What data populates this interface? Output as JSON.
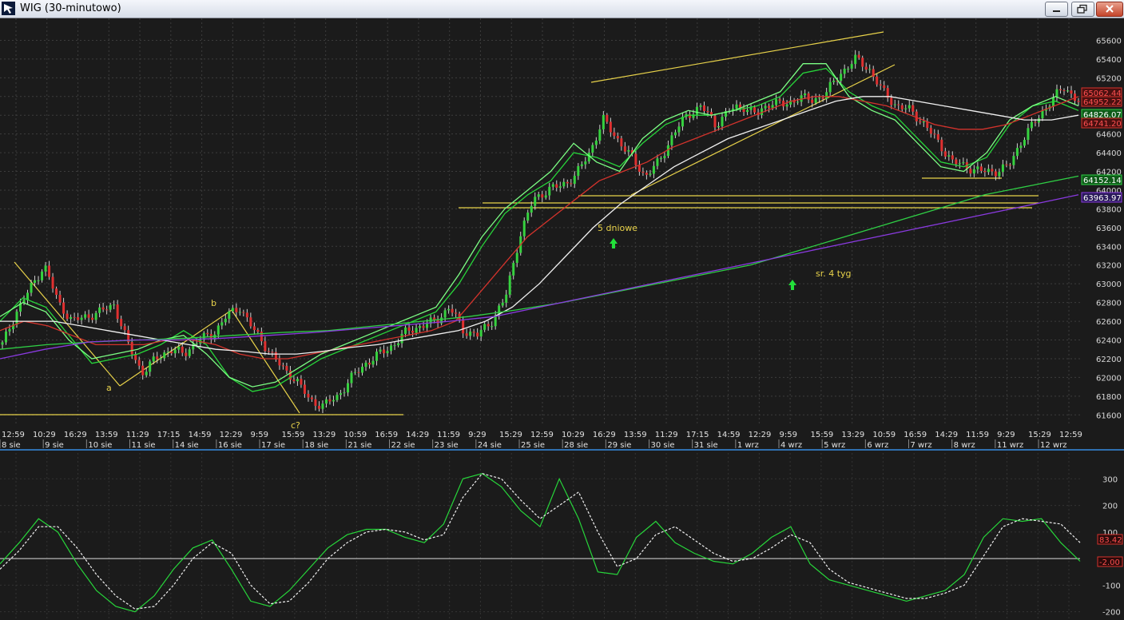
{
  "window": {
    "title": "WIG (30-minutowo)"
  },
  "chart_data": [
    {
      "type": "line",
      "panel": "price",
      "ylim": [
        61500,
        65800
      ],
      "y_ticks": [
        61600,
        61800,
        62000,
        62200,
        62400,
        62600,
        62800,
        63000,
        63200,
        63400,
        63600,
        63800,
        64000,
        64200,
        64400,
        64600,
        64800,
        65000,
        65200,
        65400,
        65600
      ],
      "y_tick_labels": [
        "61600",
        "61800",
        "62000",
        "62200",
        "62400",
        "62600",
        "62800",
        "63000",
        "63200",
        "63400",
        "63600",
        "63800",
        "64000",
        "64200",
        "64400",
        "64600",
        "64800",
        "65000",
        "65200",
        "65400",
        "65600"
      ],
      "x_time_labels": [
        "12:59",
        "10:29",
        "16:29",
        "13:59",
        "11:29",
        "17:15",
        "14:59",
        "12:29",
        "9:59",
        "15:59",
        "13:29",
        "10:59",
        "16:59",
        "14:29",
        "11:59",
        "9:29",
        "15:29",
        "12:59",
        "10:29",
        "16:29",
        "13:59",
        "11:29",
        "17:15",
        "14:59",
        "12:29",
        "9:59",
        "15:59",
        "13:29",
        "10:59",
        "16:59",
        "14:29",
        "11:59",
        "9:29",
        "15:29",
        "12:59"
      ],
      "x_date_labels": [
        "8 sie",
        "9 sie",
        "10 sie",
        "11 sie",
        "14 sie",
        "16 sie",
        "17 sie",
        "18 sie",
        "21 sie",
        "22 sie",
        "23 sie",
        "24 sie",
        "25 sie",
        "28 sie",
        "29 sie",
        "30 sie",
        "31 sie",
        "1 wrz",
        "4 wrz",
        "5 wrz",
        "6 wrz",
        "7 wrz",
        "8 wrz",
        "11 wrz",
        "12 wrz"
      ],
      "price_path": [
        62350,
        62700,
        62950,
        63200,
        62800,
        62600,
        62650,
        62700,
        62780,
        62350,
        62050,
        62200,
        62300,
        62250,
        62400,
        62450,
        62650,
        62750,
        62500,
        62300,
        62100,
        61980,
        61750,
        61700,
        61800,
        62000,
        62150,
        62250,
        62350,
        62500,
        62550,
        62600,
        62750,
        62500,
        62450,
        62600,
        62850,
        63500,
        63900,
        64000,
        64050,
        64150,
        64400,
        64750,
        64550,
        64350,
        64150,
        64300,
        64600,
        64800,
        64900,
        64700,
        64850,
        64900,
        64800,
        64950,
        64900,
        65000,
        64950,
        65050,
        65250,
        65400,
        65300,
        65050,
        64900,
        64850,
        64700,
        64500,
        64300,
        64250,
        64200,
        64200,
        64250,
        64550,
        64750,
        64950,
        65100,
        64950
      ],
      "series": [
        {
          "color": "#27d63a",
          "values": [
            62600,
            62850,
            62750,
            62450,
            62150,
            62200,
            62250,
            62350,
            62500,
            62350,
            62000,
            61850,
            61900,
            62050,
            62200,
            62300,
            62400,
            62500,
            62600,
            62700,
            63000,
            63400,
            63750,
            63950,
            64100,
            64400,
            64350,
            64250,
            64500,
            64700,
            64800,
            64800,
            64850,
            64900,
            65000,
            65250,
            65300,
            65050,
            64900,
            64800,
            64550,
            64300,
            64250,
            64350,
            64700,
            64900,
            64950,
            64850
          ]
        },
        {
          "color": "#7cff84",
          "values": [
            62650,
            62800,
            62700,
            62400,
            62200,
            62250,
            62300,
            62400,
            62450,
            62250,
            62000,
            61900,
            61950,
            62100,
            62250,
            62350,
            62450,
            62550,
            62650,
            62750,
            63100,
            63500,
            63800,
            64000,
            64200,
            64500,
            64300,
            64200,
            64550,
            64750,
            64850,
            64800,
            64850,
            64950,
            65050,
            65350,
            65350,
            65000,
            64850,
            64750,
            64500,
            64250,
            64200,
            64400,
            64750,
            64900,
            65000,
            64900
          ]
        },
        {
          "color": "#d4332c",
          "values": [
            62500,
            62600,
            62550,
            62450,
            62350,
            62350,
            62350,
            62400,
            62400,
            62350,
            62250,
            62200,
            62200,
            62250,
            62300,
            62350,
            62400,
            62450,
            62500,
            62600,
            62900,
            63200,
            63500,
            63700,
            63900,
            64100,
            64200,
            64300,
            64450,
            64550,
            64650,
            64750,
            64850,
            64950,
            65000,
            65000,
            64950,
            64900,
            64800,
            64700,
            64650,
            64650,
            64700,
            64800,
            64900,
            65000
          ]
        },
        {
          "color": "#f0f0f0",
          "values": [
            62600,
            62600,
            62600,
            62550,
            62500,
            62450,
            62400,
            62350,
            62300,
            62280,
            62250,
            62250,
            62280,
            62320,
            62350,
            62400,
            62450,
            62500,
            62600,
            62750,
            63000,
            63300,
            63600,
            63850,
            64050,
            64250,
            64400,
            64550,
            64650,
            64750,
            64850,
            64950,
            65000,
            65000,
            64950,
            64900,
            64850,
            64800,
            64750,
            64750,
            64800
          ]
        },
        {
          "color": "#2fcf45",
          "values": [
            62300,
            62350,
            62380,
            62400,
            62420,
            62450,
            62480,
            62500,
            62550,
            62600,
            62650,
            62720,
            62800,
            62900,
            63000,
            63100,
            63200,
            63350,
            63500,
            63650,
            63800,
            63950,
            64050,
            64150
          ]
        },
        {
          "color": "#8a3ae0",
          "values": [
            62200,
            62300,
            62380,
            62400,
            62400,
            62420,
            62450,
            62480,
            62520,
            62560,
            62600,
            62650,
            62750,
            62850,
            62950,
            63050,
            63150,
            63250,
            63350,
            63450,
            63550,
            63650,
            63750,
            63850,
            63950
          ]
        }
      ],
      "last_values": [
        {
          "label": "65062.44",
          "color": "#ff5050",
          "value": 65062.44
        },
        {
          "label": "64952.22",
          "color": "#ff5050",
          "value": 64952.22
        },
        {
          "label": "64826.07",
          "color": "#ffffff",
          "value": 64826.07
        },
        {
          "label": "64741.20",
          "color": "#ff5050",
          "value": 64741.2
        },
        {
          "label": "64152.14",
          "color": "#ffffff",
          "value": 64152.14
        },
        {
          "label": "63963.97",
          "color": "#ffffff",
          "value": 63963.97
        }
      ],
      "annotations": {
        "wave_labels": [
          "a",
          "b",
          "c?"
        ],
        "text_5day": "5 dniowe",
        "text_4week": "sr. 4 tyg"
      }
    },
    {
      "type": "line",
      "panel": "oscillator",
      "ylim": [
        -210,
        340
      ],
      "y_ticks": [
        -200,
        -100,
        0,
        100,
        200,
        300
      ],
      "y_tick_labels": [
        "-200",
        "-100",
        "",
        "100",
        "200",
        "300"
      ],
      "series": [
        {
          "color": "#27d63a",
          "values": [
            -20,
            60,
            150,
            100,
            -20,
            -120,
            -180,
            -200,
            -140,
            -40,
            40,
            70,
            -40,
            -160,
            -180,
            -120,
            -40,
            40,
            90,
            110,
            110,
            80,
            60,
            130,
            300,
            320,
            270,
            180,
            120,
            300,
            150,
            -50,
            -60,
            80,
            140,
            60,
            20,
            -10,
            -20,
            20,
            80,
            120,
            -20,
            -80,
            -100,
            -120,
            -140,
            -160,
            -140,
            -120,
            -60,
            80,
            150,
            140,
            150,
            60,
            -10
          ]
        },
        {
          "color": "#f0f0f0",
          "values": [
            -40,
            30,
            120,
            120,
            40,
            -60,
            -140,
            -190,
            -180,
            -100,
            0,
            60,
            20,
            -100,
            -170,
            -160,
            -90,
            0,
            60,
            100,
            110,
            100,
            70,
            90,
            230,
            320,
            300,
            220,
            150,
            200,
            250,
            100,
            -30,
            0,
            90,
            120,
            70,
            20,
            -10,
            0,
            40,
            90,
            60,
            -40,
            -90,
            -110,
            -130,
            -150,
            -150,
            -130,
            -100,
            10,
            120,
            150,
            140,
            130,
            60
          ]
        }
      ],
      "last_values": [
        {
          "label": "83.42",
          "color": "#ff5050",
          "value": 83.42
        },
        {
          "label": "-2.00",
          "color": "#ff5050",
          "value": -2.0
        }
      ]
    }
  ]
}
